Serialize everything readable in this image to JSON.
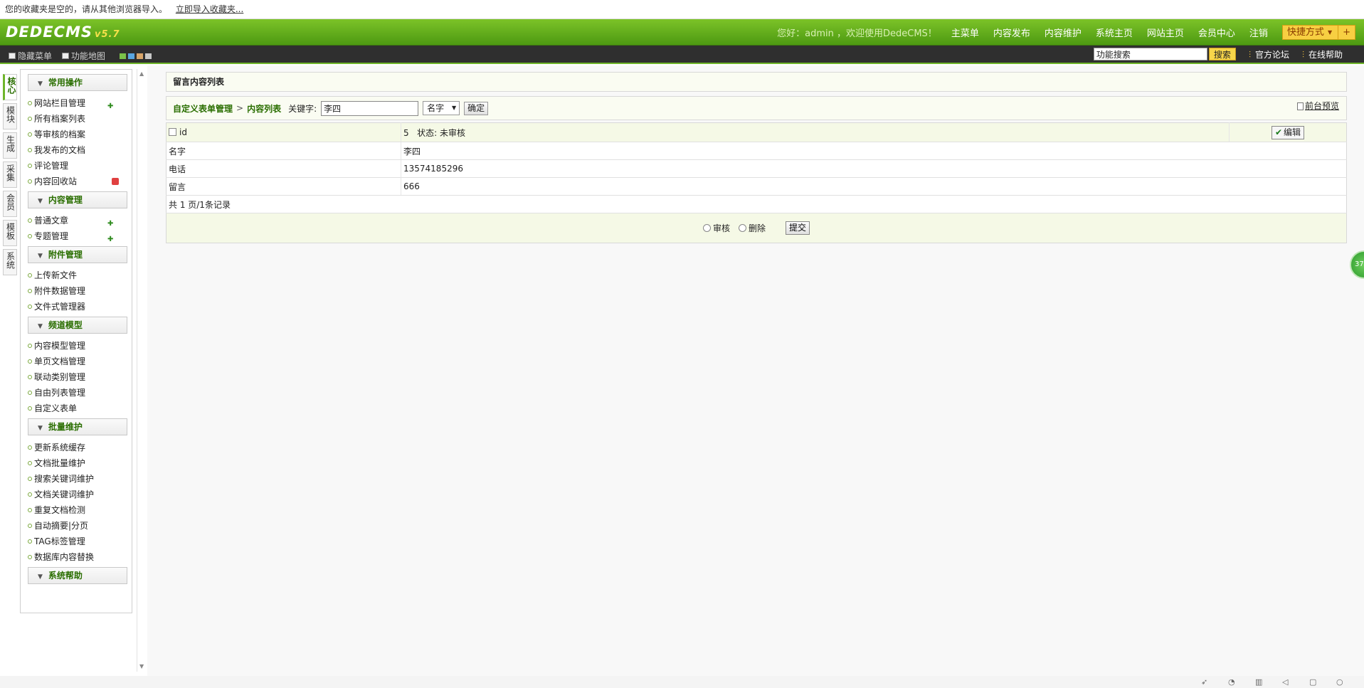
{
  "bookmark_bar": {
    "message": "您的收藏夹是空的，请从其他浏览器导入。",
    "import_link": "立即导入收藏夹..."
  },
  "header": {
    "logo": "DEDECMS",
    "version": "v5.7",
    "welcome": "您好：admin ，欢迎使用DedeCMS！",
    "nav": [
      "主菜单",
      "内容发布",
      "内容维护",
      "系统主页",
      "网站主页",
      "会员中心",
      "注销"
    ],
    "quick": "快捷方式",
    "quick_plus": "+"
  },
  "subbar": {
    "hide_menu": "隐藏菜单",
    "site_map": "功能地图",
    "swatch_colors": [
      "#7bc24a",
      "#5aa6e0",
      "#d8a56a",
      "#c8c8c8"
    ],
    "search_value": "功能搜索",
    "search_button": "搜索",
    "forum_link": "官方论坛",
    "help_link": "在线帮助"
  },
  "side_tabs": [
    "核心",
    "模块",
    "生成",
    "采集",
    "会员",
    "模板",
    "系统"
  ],
  "menu": {
    "groups": [
      {
        "title": "常用操作",
        "items": [
          "网站栏目管理",
          "所有档案列表",
          "等审核的档案",
          "我发布的文档",
          "评论管理",
          "内容回收站"
        ]
      },
      {
        "title": "内容管理",
        "items": [
          "普通文章",
          "专题管理"
        ]
      },
      {
        "title": "附件管理",
        "items": [
          "上传新文件",
          "附件数据管理",
          "文件式管理器"
        ]
      },
      {
        "title": "频道模型",
        "items": [
          "内容模型管理",
          "单页文档管理",
          "联动类别管理",
          "自由列表管理",
          "自定义表单"
        ]
      },
      {
        "title": "批量维护",
        "items": [
          "更新系统缓存",
          "文档批量维护",
          "搜索关键词维护",
          "文档关键词维护",
          "重复文档检测",
          "自动摘要|分页",
          "TAG标签管理",
          "数据库内容替换"
        ]
      },
      {
        "title": "系统帮助",
        "items": []
      }
    ]
  },
  "panel": {
    "title": "留言内容列表",
    "crumb_1": "自定义表单管理",
    "crumb_sep": ">",
    "crumb_2": "内容列表",
    "keyword_label": "关键字:",
    "keyword_value": "李四",
    "field_select": "名字",
    "confirm": "确定",
    "preview": "前台预览"
  },
  "table": {
    "head": {
      "id_label": "id",
      "id_value": "5",
      "status": "状态: 未审核",
      "edit": "编辑"
    },
    "rows": [
      {
        "label": "名字",
        "value": "李四"
      },
      {
        "label": "电话",
        "value": "13574185296"
      },
      {
        "label": "留言",
        "value": "666"
      }
    ],
    "pager": "共 1 页/1条记录"
  },
  "actions": {
    "approve": "审核",
    "delete": "删除",
    "submit": "提交"
  },
  "badge": "37"
}
